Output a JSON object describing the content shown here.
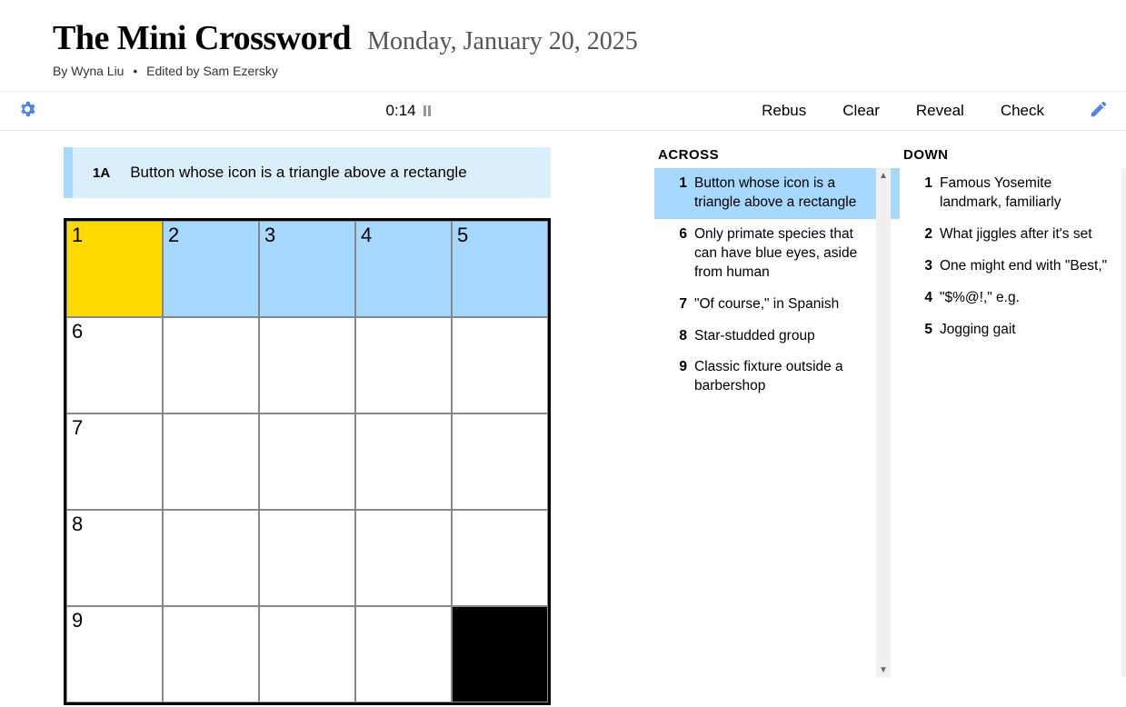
{
  "header": {
    "title": "The Mini Crossword",
    "date": "Monday, January 20, 2025",
    "byline_prefix": "By",
    "author": "Wyna Liu",
    "editor_prefix": "Edited by",
    "editor": "Sam Ezersky"
  },
  "toolbar": {
    "timer": "0:14",
    "rebus": "Rebus",
    "clear": "Clear",
    "reveal": "Reveal",
    "check": "Check"
  },
  "active_clue": {
    "label": "1A",
    "text": "Button whose icon is a triangle above a rectangle"
  },
  "clue_lists": {
    "across_label": "ACROSS",
    "down_label": "DOWN"
  },
  "across": [
    {
      "n": "1",
      "text": "Button whose icon is a triangle above a rectangle",
      "selected": true
    },
    {
      "n": "6",
      "text": "Only primate species that can have blue eyes, aside from human"
    },
    {
      "n": "7",
      "text": "\"Of course,\" in Spanish"
    },
    {
      "n": "8",
      "text": "Star-studded group"
    },
    {
      "n": "9",
      "text": "Classic fixture outside a barbershop"
    }
  ],
  "down": [
    {
      "n": "1",
      "text": "Famous Yosemite landmark, familiarly",
      "related": true
    },
    {
      "n": "2",
      "text": "What jiggles after it's set"
    },
    {
      "n": "3",
      "text": "One might end with \"Best,\""
    },
    {
      "n": "4",
      "text": "\"$%@!,\" e.g."
    },
    {
      "n": "5",
      "text": "Jogging gait"
    }
  ],
  "grid": {
    "size": 5,
    "cells": [
      {
        "n": "1",
        "state": "focus"
      },
      {
        "n": "2",
        "state": "hl"
      },
      {
        "n": "3",
        "state": "hl"
      },
      {
        "n": "4",
        "state": "hl"
      },
      {
        "n": "5",
        "state": "hl"
      },
      {
        "n": "6"
      },
      {
        "n": ""
      },
      {
        "n": ""
      },
      {
        "n": ""
      },
      {
        "n": ""
      },
      {
        "n": "7"
      },
      {
        "n": ""
      },
      {
        "n": ""
      },
      {
        "n": ""
      },
      {
        "n": ""
      },
      {
        "n": "8"
      },
      {
        "n": ""
      },
      {
        "n": ""
      },
      {
        "n": ""
      },
      {
        "n": ""
      },
      {
        "n": "9"
      },
      {
        "n": ""
      },
      {
        "n": ""
      },
      {
        "n": ""
      },
      {
        "n": "",
        "state": "black"
      }
    ]
  }
}
